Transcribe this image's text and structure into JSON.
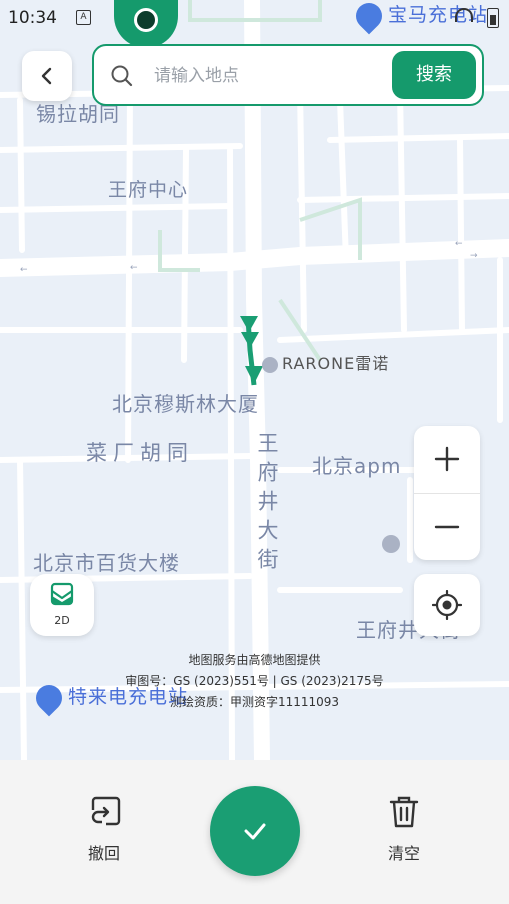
{
  "status_bar": {
    "time": "10:34",
    "notification_glyph": "A"
  },
  "search": {
    "placeholder": "请输入地点",
    "value": "",
    "button_label": "搜索"
  },
  "map_labels": {
    "hutong_top": "锡拉胡同",
    "wangfu_center": "王府中心",
    "rarone": "RARONE雷诺",
    "mosque_building": "北京穆斯林大厦",
    "caichang_hutong": "菜厂胡同",
    "wangfujing_street_vertical": "王府井大街",
    "beijing_apm": "北京apm",
    "department_store": "北京市百货大楼",
    "wangfujing_street_right": "王府井大街",
    "baoma_charging": "宝马充电站",
    "telai_charging": "特来电充电站"
  },
  "map_mode": {
    "label": "2D"
  },
  "credits": {
    "line1": "地图服务由高德地图提供",
    "line2": "审图号：GS (2023)551号 | GS (2023)2175号",
    "line3": "测绘资质：甲测资字11111093"
  },
  "toolbar": {
    "undo_label": "撤回",
    "clear_label": "清空"
  },
  "colors": {
    "accent": "#159a6c",
    "map_bg": "#eaf0f8",
    "label": "#7a87a6"
  },
  "icons": {
    "back": "chevron-left-icon",
    "search": "search-icon",
    "zoom_in": "plus-icon",
    "zoom_out": "minus-icon",
    "locate": "locate-icon",
    "map_mode": "map-icon",
    "undo": "undo-icon",
    "clear": "trash-icon",
    "confirm": "check-icon"
  }
}
